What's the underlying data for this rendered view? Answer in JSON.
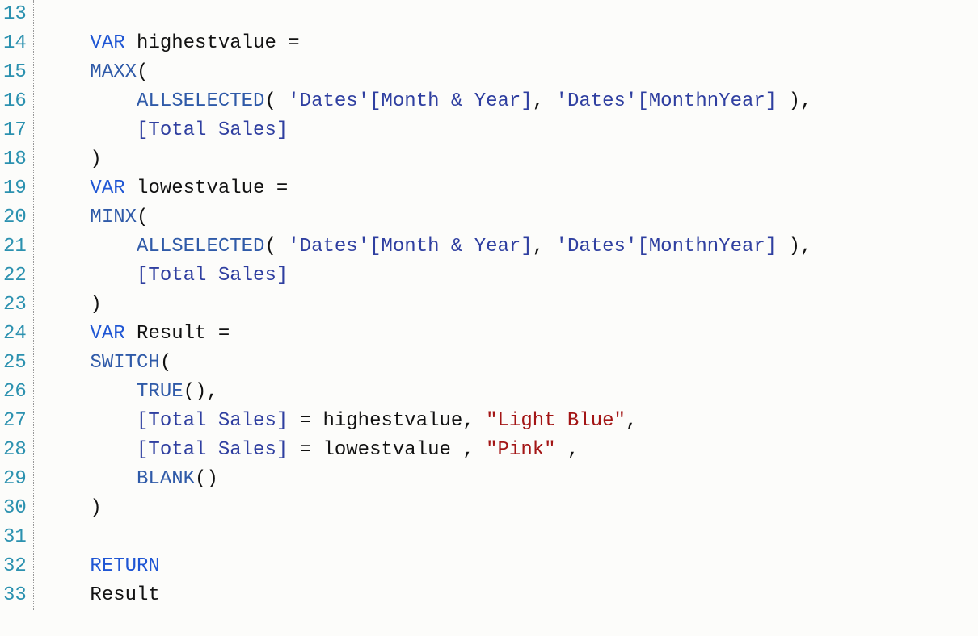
{
  "editor": {
    "first_line": 13,
    "lines": [
      {
        "n": 13,
        "tokens": []
      },
      {
        "n": 14,
        "tokens": [
          {
            "t": "    ",
            "c": "pun"
          },
          {
            "t": "VAR",
            "c": "kw"
          },
          {
            "t": " highestvalue ",
            "c": "ident"
          },
          {
            "t": "=",
            "c": "pun"
          }
        ]
      },
      {
        "n": 15,
        "tokens": [
          {
            "t": "    ",
            "c": "pun"
          },
          {
            "t": "MAXX",
            "c": "fn"
          },
          {
            "t": "(",
            "c": "pun"
          }
        ]
      },
      {
        "n": 16,
        "tokens": [
          {
            "t": "        ",
            "c": "pun"
          },
          {
            "t": "ALLSELECTED",
            "c": "fn"
          },
          {
            "t": "( ",
            "c": "pun"
          },
          {
            "t": "'Dates'[Month & Year]",
            "c": "col"
          },
          {
            "t": ", ",
            "c": "pun"
          },
          {
            "t": "'Dates'[MonthnYear]",
            "c": "col"
          },
          {
            "t": " ),",
            "c": "pun"
          }
        ]
      },
      {
        "n": 17,
        "tokens": [
          {
            "t": "        ",
            "c": "pun"
          },
          {
            "t": "[Total Sales]",
            "c": "col"
          }
        ]
      },
      {
        "n": 18,
        "tokens": [
          {
            "t": "    ",
            "c": "pun"
          },
          {
            "t": ")",
            "c": "pun"
          }
        ]
      },
      {
        "n": 19,
        "tokens": [
          {
            "t": "    ",
            "c": "pun"
          },
          {
            "t": "VAR",
            "c": "kw"
          },
          {
            "t": " lowestvalue ",
            "c": "ident"
          },
          {
            "t": "=",
            "c": "pun"
          }
        ]
      },
      {
        "n": 20,
        "tokens": [
          {
            "t": "    ",
            "c": "pun"
          },
          {
            "t": "MINX",
            "c": "fn"
          },
          {
            "t": "(",
            "c": "pun"
          }
        ]
      },
      {
        "n": 21,
        "tokens": [
          {
            "t": "        ",
            "c": "pun"
          },
          {
            "t": "ALLSELECTED",
            "c": "fn"
          },
          {
            "t": "( ",
            "c": "pun"
          },
          {
            "t": "'Dates'[Month & Year]",
            "c": "col"
          },
          {
            "t": ", ",
            "c": "pun"
          },
          {
            "t": "'Dates'[MonthnYear]",
            "c": "col"
          },
          {
            "t": " ),",
            "c": "pun"
          }
        ]
      },
      {
        "n": 22,
        "tokens": [
          {
            "t": "        ",
            "c": "pun"
          },
          {
            "t": "[Total Sales]",
            "c": "col"
          }
        ]
      },
      {
        "n": 23,
        "tokens": [
          {
            "t": "    ",
            "c": "pun"
          },
          {
            "t": ")",
            "c": "pun"
          }
        ]
      },
      {
        "n": 24,
        "tokens": [
          {
            "t": "    ",
            "c": "pun"
          },
          {
            "t": "VAR",
            "c": "kw"
          },
          {
            "t": " Result ",
            "c": "ident"
          },
          {
            "t": "=",
            "c": "pun"
          }
        ]
      },
      {
        "n": 25,
        "tokens": [
          {
            "t": "    ",
            "c": "pun"
          },
          {
            "t": "SWITCH",
            "c": "fn"
          },
          {
            "t": "(",
            "c": "pun"
          }
        ]
      },
      {
        "n": 26,
        "tokens": [
          {
            "t": "        ",
            "c": "pun"
          },
          {
            "t": "TRUE",
            "c": "fn"
          },
          {
            "t": "(),",
            "c": "pun"
          }
        ]
      },
      {
        "n": 27,
        "tokens": [
          {
            "t": "        ",
            "c": "pun"
          },
          {
            "t": "[Total Sales]",
            "c": "col"
          },
          {
            "t": " = highestvalue, ",
            "c": "ident"
          },
          {
            "t": "\"Light Blue\"",
            "c": "str"
          },
          {
            "t": ",",
            "c": "pun"
          }
        ]
      },
      {
        "n": 28,
        "tokens": [
          {
            "t": "        ",
            "c": "pun"
          },
          {
            "t": "[Total Sales]",
            "c": "col"
          },
          {
            "t": " = lowestvalue , ",
            "c": "ident"
          },
          {
            "t": "\"Pink\"",
            "c": "str"
          },
          {
            "t": " ,",
            "c": "pun"
          }
        ]
      },
      {
        "n": 29,
        "tokens": [
          {
            "t": "        ",
            "c": "pun"
          },
          {
            "t": "BLANK",
            "c": "fn"
          },
          {
            "t": "()",
            "c": "pun"
          }
        ]
      },
      {
        "n": 30,
        "tokens": [
          {
            "t": "    ",
            "c": "pun"
          },
          {
            "t": ")",
            "c": "pun"
          }
        ]
      },
      {
        "n": 31,
        "tokens": []
      },
      {
        "n": 32,
        "tokens": [
          {
            "t": "    ",
            "c": "pun"
          },
          {
            "t": "RETURN",
            "c": "kw"
          }
        ]
      },
      {
        "n": 33,
        "tokens": [
          {
            "t": "    ",
            "c": "pun"
          },
          {
            "t": "Result",
            "c": "ident"
          }
        ]
      }
    ]
  }
}
